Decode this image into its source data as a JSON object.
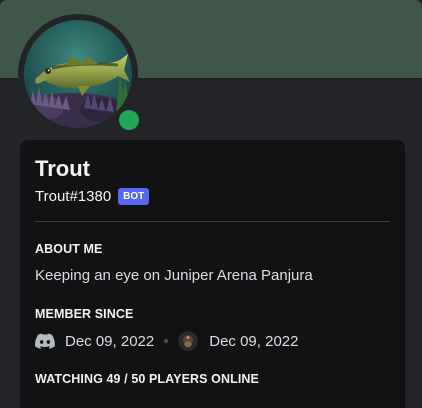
{
  "profile": {
    "username": "Trout",
    "tag": "Trout#1380",
    "badge": "BOT",
    "status": "online"
  },
  "sections": {
    "about_heading": "ABOUT ME",
    "about_text": "Keeping an eye on Juniper Arena Panjura",
    "member_heading": "MEMBER SINCE",
    "discord_member_since": "Dec 09, 2022",
    "server_member_since": "Dec 09, 2022",
    "activity_heading": "WATCHING 49 / 50 PLAYERS ONLINE"
  },
  "icons": {
    "avatar": "largemouth-bass-fish-avatar",
    "status": "online-status-icon",
    "discord": "discord-logo-icon",
    "server": "server-icon"
  },
  "colors": {
    "banner": "#3e5749",
    "background": "#232428",
    "card": "#111214",
    "bot_badge": "#5865f2",
    "online": "#23a559",
    "text_primary": "#f2f3f5",
    "text_secondary": "#dbdee1"
  }
}
